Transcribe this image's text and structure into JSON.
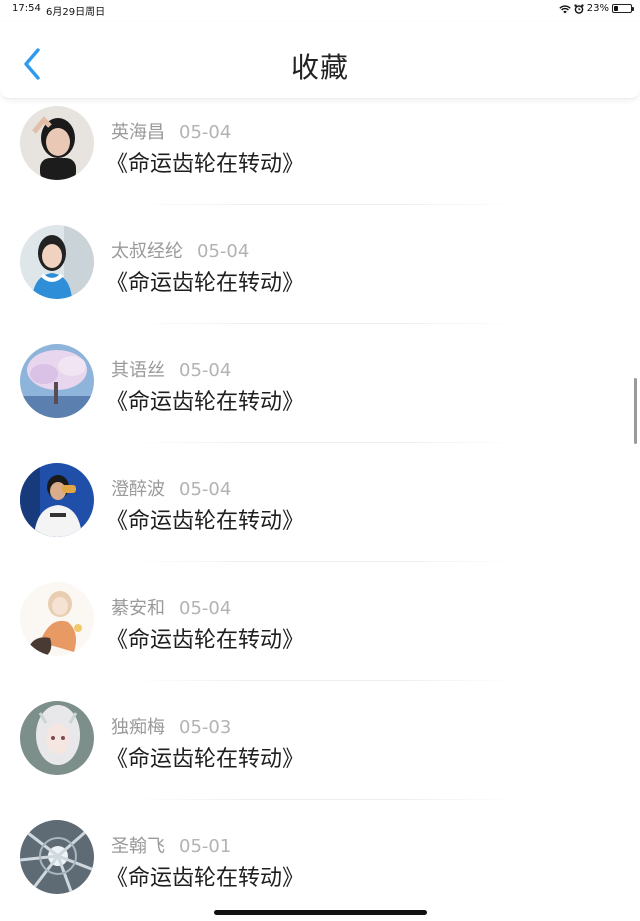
{
  "status_bar": {
    "time": "17:54",
    "date": "6月29日周日",
    "battery": "23%",
    "battery_level": 0.23
  },
  "nav": {
    "title": "收藏"
  },
  "items": [
    {
      "name": "英海昌",
      "date": "05-04",
      "title": "《命运齿轮在转动》"
    },
    {
      "name": "太叔经纶",
      "date": "05-04",
      "title": "《命运齿轮在转动》"
    },
    {
      "name": "其语丝",
      "date": "05-04",
      "title": "《命运齿轮在转动》"
    },
    {
      "name": "澄醉波",
      "date": "05-04",
      "title": "《命运齿轮在转动》"
    },
    {
      "name": "綦安和",
      "date": "05-04",
      "title": "《命运齿轮在转动》"
    },
    {
      "name": "独痴梅",
      "date": "05-03",
      "title": "《命运齿轮在转动》"
    },
    {
      "name": "圣翰飞",
      "date": "05-01",
      "title": "《命运齿轮在转动》"
    }
  ],
  "colors": {
    "accent": "#2f9bf0",
    "title_text": "#1e1e1e",
    "meta_text": "#9a9a9a"
  }
}
